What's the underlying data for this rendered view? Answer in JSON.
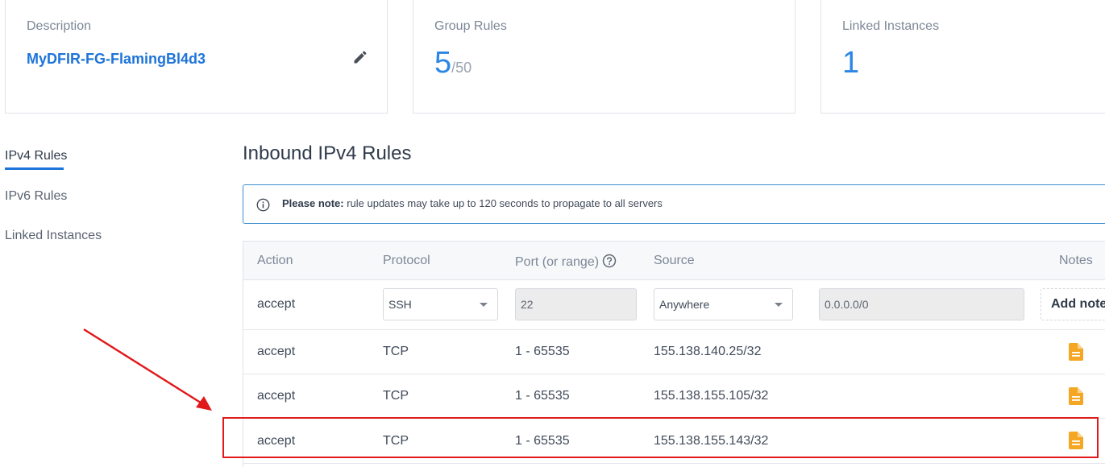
{
  "cards": {
    "description": {
      "label": "Description",
      "value": "MyDFIR-FG-FlamingBl4d3"
    },
    "group_rules": {
      "label": "Group Rules",
      "count": "5",
      "max": "/50"
    },
    "linked_instances": {
      "label": "Linked Instances",
      "count": "1"
    }
  },
  "tabs": {
    "ipv4": "IPv4 Rules",
    "ipv6": "IPv6 Rules",
    "linked": "Linked Instances"
  },
  "section_title": "Inbound IPv4 Rules",
  "notice": {
    "bold": "Please note:",
    "text": " rule updates may take up to 120 seconds to propagate to all servers"
  },
  "table": {
    "headers": {
      "action": "Action",
      "protocol": "Protocol",
      "port": "Port (or range)",
      "source": "Source",
      "notes": "Notes"
    },
    "new_rule": {
      "action": "accept",
      "protocol": "SSH",
      "port": "22",
      "source_type": "Anywhere",
      "source_value": "0.0.0.0/0",
      "add_note": "Add note"
    },
    "rows": [
      {
        "action": "accept",
        "protocol": "TCP",
        "port": "1 - 65535",
        "source": "155.138.140.25/32"
      },
      {
        "action": "accept",
        "protocol": "TCP",
        "port": "1 - 65535",
        "source": "155.138.155.105/32"
      },
      {
        "action": "accept",
        "protocol": "TCP",
        "port": "1 - 65535",
        "source": "155.138.155.143/32"
      }
    ]
  },
  "icons": {
    "edit": "pencil-icon",
    "info": "info-circle-icon",
    "help": "question-circle-icon",
    "note": "document-note-icon"
  },
  "colors": {
    "accent": "#1e74d9",
    "note_icon": "#f5a623",
    "annotation": "#e0191b"
  }
}
